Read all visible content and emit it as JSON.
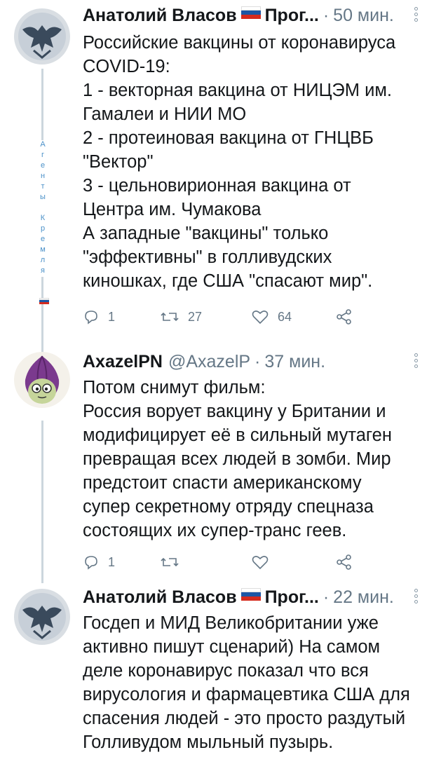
{
  "tweets": [
    {
      "author": "Анатолий Власов",
      "handle": "Прог...",
      "time": "50 мин.",
      "lines": [
        "Российские вакцины от коронавируса",
        "COVID-19:",
        "1 - векторная вакцина от НИЦЭМ им.",
        "Гамалеи и НИИ МО",
        "2 - протеиновая вакцина от ГНЦВБ",
        "\"Вектор\"",
        "3 - цельновирионная вакцина от",
        "Центра им. Чумакова",
        "А западные \"вакцины\" только",
        "\"эффективны\" в голливудских",
        "киношках, где США \"спасают мир\"."
      ],
      "replies": "1",
      "retweets": "27",
      "likes": "64"
    },
    {
      "author": "AxazelPN",
      "handle": "@AxazelP",
      "time": "37 мин.",
      "lines": [
        "Потом снимут фильм:",
        "Россия ворует вакцину у Британии и",
        "модифицирует её в сильный мутаген",
        "превращая всех людей в зомби. Мир",
        "предстоит спасти американскому",
        "супер секретному отряду спецназа",
        "состоящих их супер-транс геев."
      ],
      "replies": "1",
      "retweets": "",
      "likes": ""
    },
    {
      "author": "Анатолий Власов",
      "handle": "Прог...",
      "time": "22 мин.",
      "lines": [
        "Госдеп и МИД Великобритании уже",
        "активно пишут сценарий) На самом",
        "деле коронавирус показал что вся",
        "вирусология и фармацевтика США для",
        "спасения людей - это просто раздутый",
        "Голливудом мыльный пузырь."
      ]
    }
  ],
  "vertical_caption": [
    "А",
    "г",
    "е",
    "н",
    "т",
    "ы",
    "",
    "К",
    "р",
    "е",
    "м",
    "л",
    "я"
  ],
  "colors": {
    "muted": "#657786",
    "line": "#ccd6dd",
    "flag_white": "#ffffff",
    "flag_blue": "#1c57a5",
    "flag_red": "#d52b1e"
  }
}
